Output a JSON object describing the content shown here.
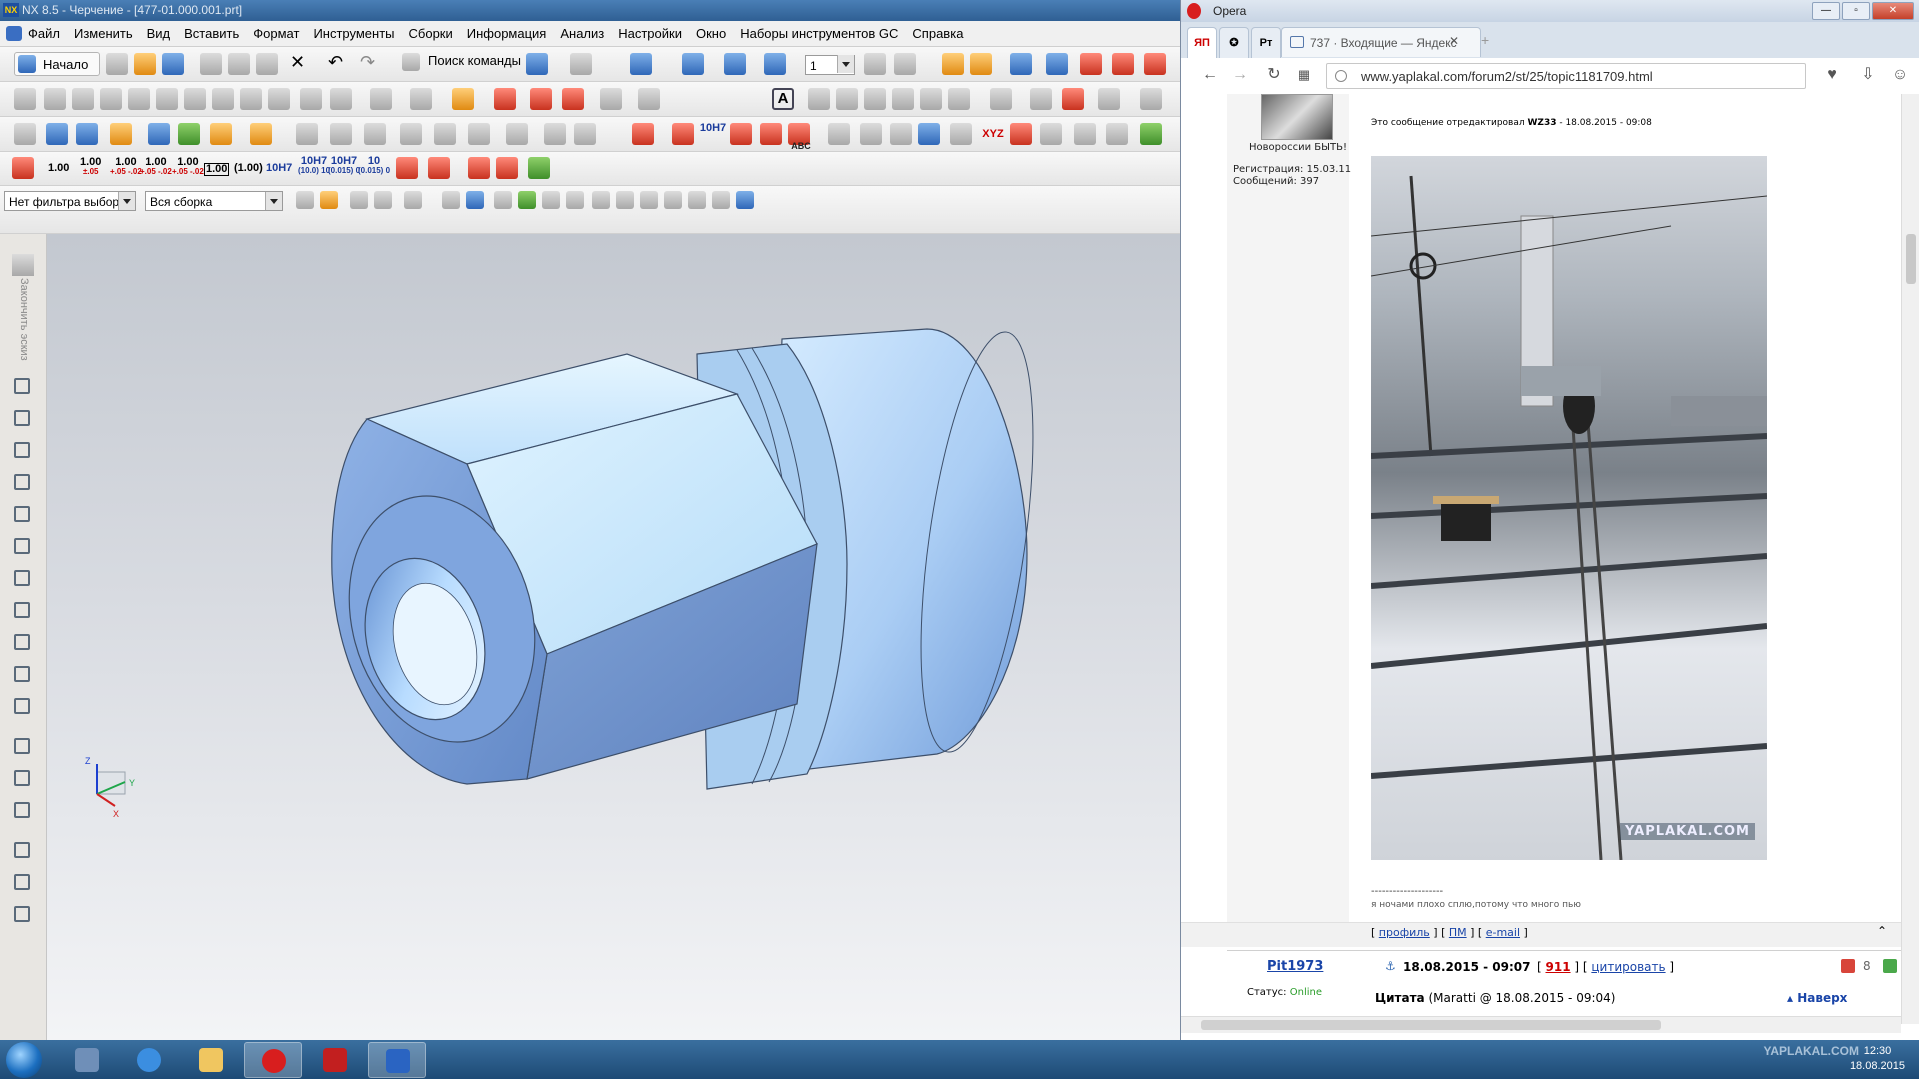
{
  "nx": {
    "title": "NX 8.5 - Черчение - [477-01.000.001.prt]",
    "logo": "NX",
    "menu": [
      "Файл",
      "Изменить",
      "Вид",
      "Вставить",
      "Формат",
      "Инструменты",
      "Сборки",
      "Информация",
      "Анализ",
      "Настройки",
      "Окно",
      "Наборы инструментов GC",
      "Справка"
    ],
    "start_label": "Начало",
    "search_command_label": "Поиск команды",
    "layer_value": "1",
    "tolerance_buttons": [
      {
        "main": "1.00",
        "sub": ""
      },
      {
        "main": "1.00",
        "sub": "±.05"
      },
      {
        "main": "1.00",
        "sub": "+.05 -.02"
      },
      {
        "main": "1.00",
        "sub": "+.05 -.02"
      },
      {
        "main": "1.00",
        "sub": "+.05 -.02"
      },
      {
        "main": "1.00",
        "sub": "boxed"
      },
      {
        "main": "(1.00)",
        "sub": ""
      },
      {
        "main": "10H7",
        "sub": ""
      },
      {
        "main": "10H7",
        "sub": "(10.0) 10"
      },
      {
        "main": "10H7",
        "sub": "(0.015) 0"
      },
      {
        "main": "10",
        "sub": "(0.015) 0"
      }
    ],
    "filter_select": "Нет фильтра выбор",
    "assembly_select": "Вся сборка",
    "sketch_finish_label": "Закончить эскиз",
    "dim_label_abc": "ABC",
    "xyz_label": "XYZ",
    "triad": {
      "x": "X",
      "y": "Y",
      "z": "Z"
    }
  },
  "opera": {
    "app_name": "Opera",
    "tab_pinned_1": "ЯП",
    "tab_pinned_3": "Рт",
    "tab_title": "737 · Входящие — Яндекс",
    "url": "www.yaplakal.com/forum2/st/25/topic1181709.html",
    "post1": {
      "user_caption": "Новороссии БЫТЬ!",
      "registration": "Регистрация: 15.03.11",
      "messages": "Сообщений: 397",
      "edited_note": "Это сообщение отредактировал",
      "edited_by": "WZ33",
      "edited_time": "- 18.08.2015 - 09:08",
      "photo_watermark": "YAPLAKAL.COM",
      "signature_sep": "--------------------",
      "signature": "я ночами плохо сплю,потому что много пью",
      "links": [
        "профиль",
        "ПМ",
        "e-mail"
      ]
    },
    "post2": {
      "username": "Pit1973",
      "datetime": "18.08.2015 - 09:07",
      "rating": "911",
      "quote_link": "цитировать",
      "votes": "8",
      "status_label": "Статус:",
      "status_value": "Online",
      "quote_header": "Цитата",
      "quote_source": "(Maratti @ 18.08.2015 - 09:04)",
      "top_link": "Наверх"
    }
  },
  "taskbar": {
    "clock_time": "12:30",
    "clock_date": "18.08.2015",
    "watermark": "YAPLAKAL.COM"
  },
  "colors": {
    "nx_title_bg": "#2f5f93",
    "part_blue": "#8fb4e8",
    "opera_red": "#d81e1e",
    "taskbar": "#1d4a75"
  }
}
